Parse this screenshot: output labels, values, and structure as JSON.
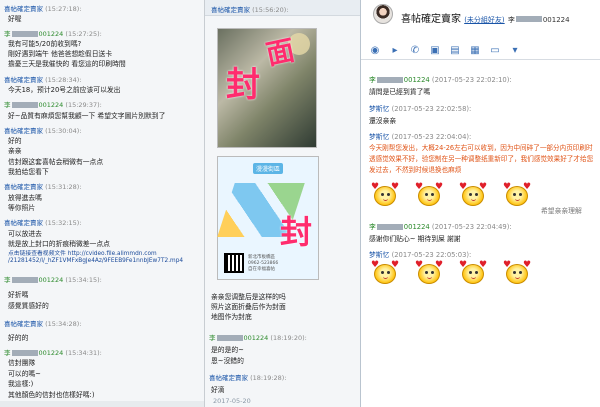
{
  "left": {
    "messages": [
      {
        "name": "喜帖確定賣家",
        "name_color": "blue",
        "time": "(15:27:18):",
        "lines": [
          "好喔"
        ]
      },
      {
        "name": "李",
        "suffix": "001224",
        "name_color": "green",
        "time": "(15:27:25):",
        "lines": [
          "我有可能5/20前收到嗎?",
          "剛好遇到端午 他爸爸想趁假日送卡",
          "擔憂三天是我催快的 看您這的印刷時間"
        ]
      },
      {
        "name": "喜帖確定賣家",
        "name_color": "blue",
        "time": "(15:28:34):",
        "lines": [
          "今天18，预计20号之前应该可以发出"
        ]
      },
      {
        "name": "李",
        "suffix": "001224",
        "name_color": "green",
        "time": "(15:29:37):",
        "lines": [
          "好~品質有麻煩您幫我顧一下 希望文字圖片別默到了"
        ]
      },
      {
        "name": "喜帖確定賣家",
        "name_color": "blue",
        "time": "(15:30:04):",
        "lines": [
          "好的",
          "亲亲",
          "信封跟这套喜帖会稍微有一点点",
          "我拍给您看下"
        ]
      },
      {
        "name": "喜帖確定賣家",
        "name_color": "blue",
        "time": "(15:31:28):",
        "lines": [
          "放得進去嗎",
          "等你照片"
        ]
      },
      {
        "name": "喜帖確定賣家",
        "name_color": "blue",
        "time": "(15:32:15):",
        "lines": [
          "可以放进去",
          "就是放上封口的折痕稍微差一点点",
          "点击链接查看视频文件 http://cvideo.file.alimmdn.com",
          "/21281452/l/_hZF1VMFxBgJe4Az/9FEEB9Fe1nnbJEw7T2.mp4"
        ]
      },
      {
        "name": "李",
        "suffix": "001224",
        "name_color": "green",
        "time": "(15:34:15):",
        "lines": [
          "好折嗎",
          "感覺質感好的"
        ]
      },
      {
        "name": "喜帖確定賣家",
        "name_color": "blue",
        "time": "(15:34:28):",
        "lines": [
          "好的的"
        ]
      },
      {
        "name": "李",
        "suffix": "001224",
        "name_color": "green",
        "time": "(15:34:31):",
        "lines": [
          "信封團隊",
          "可以的嗎~",
          "我這樣:)",
          "其他顏色的信封也信樣好嗎:)"
        ]
      }
    ]
  },
  "mid": {
    "header": {
      "name": "喜帖確定賣家",
      "time": "(15:56:20):"
    },
    "photo_text_1": "封",
    "photo_text_2": "面",
    "map_title": "漫漫街區",
    "map_big": "封",
    "map_addr": [
      "新北市板橋區",
      "0962-523866",
      "自在幸福喜帖"
    ],
    "messages": [
      {
        "name": "",
        "lines": [
          "亲亲您调整后是这样的吗",
          "照片这面折叠后作为封面",
          "地图作为封底"
        ]
      },
      {
        "name": "李",
        "suffix": "001224",
        "name_color": "green",
        "time": "(18:19:20):",
        "lines": [
          "是的是的~",
          "恩~沒錯的"
        ]
      },
      {
        "name": "喜帖確定賣家",
        "name_color": "blue",
        "time": "(18:19:28):",
        "lines": [
          "好滴"
        ]
      }
    ],
    "date_divider": "2017-05-20"
  },
  "right": {
    "title": "喜帖確定賣家",
    "status": "(未分組好友)",
    "contact": "李",
    "contact_suffix": "001224",
    "tools": [
      "chat-icon",
      "video-icon",
      "phone-icon",
      "folder-icon",
      "calendar-icon",
      "grid-icon",
      "screen-icon",
      "more-icon"
    ],
    "tool_glyphs": [
      "◉",
      "▸",
      "✆",
      "▣",
      "▤",
      "▦",
      "▭",
      "▾"
    ],
    "messages": [
      {
        "name": "李",
        "suffix": "001224",
        "name_color": "green",
        "time": "(2017-05-23 22:02:10):",
        "lines": [
          "請問是已經到貨了嗎"
        ]
      },
      {
        "name": "梦斯忆",
        "name_color": "blue",
        "time": "(2017-05-23 22:02:58):",
        "lines": [
          "還沒亲亲"
        ]
      },
      {
        "name": "梦斯忆",
        "name_color": "blue",
        "time": "(2017-05-23 22:04:04):",
        "paragraph": "今天刚帮您发出，大概24-26左右可以收到，因为中间碎了一部分内页印刷时透感觉效果不好，验您制在另一种调整纸重新印了，我们感觉效果好了才给您发过去，不然到时候退换也麻烦"
      },
      {
        "name": "李",
        "suffix": "001224",
        "name_color": "green",
        "time": "(2017-05-23 22:04:49):",
        "lines": [
          "感谢你们贴心~ 期待到屎 謝謝"
        ]
      },
      {
        "name": "梦斯忆",
        "name_color": "blue",
        "time": "(2017-05-23 22:05:03):",
        "lines": []
      }
    ],
    "sticker_caption": "希望亲亲理解"
  }
}
